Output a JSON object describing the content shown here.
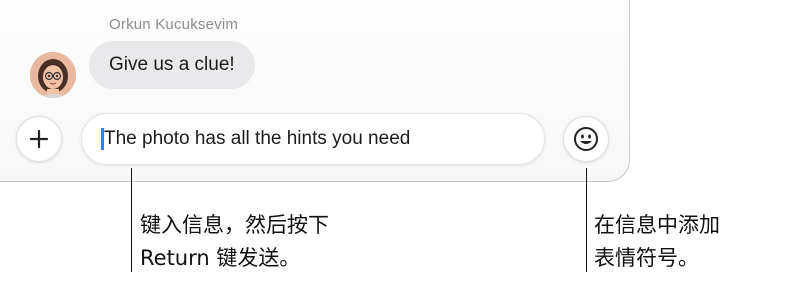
{
  "conversation": {
    "sender_name": "Orkun Kucuksevim",
    "message_text": "Give us a clue!"
  },
  "composer": {
    "input_value": "The photo has all the hints you need",
    "plus_icon": "plus-icon",
    "emoji_icon": "emoji-smiley-icon",
    "caret_color": "#2f7df6"
  },
  "callouts": {
    "typing_text": "键入信息，然后按下\nReturn 键发送。",
    "emoji_text": "在信息中添加\n表情符号。"
  }
}
